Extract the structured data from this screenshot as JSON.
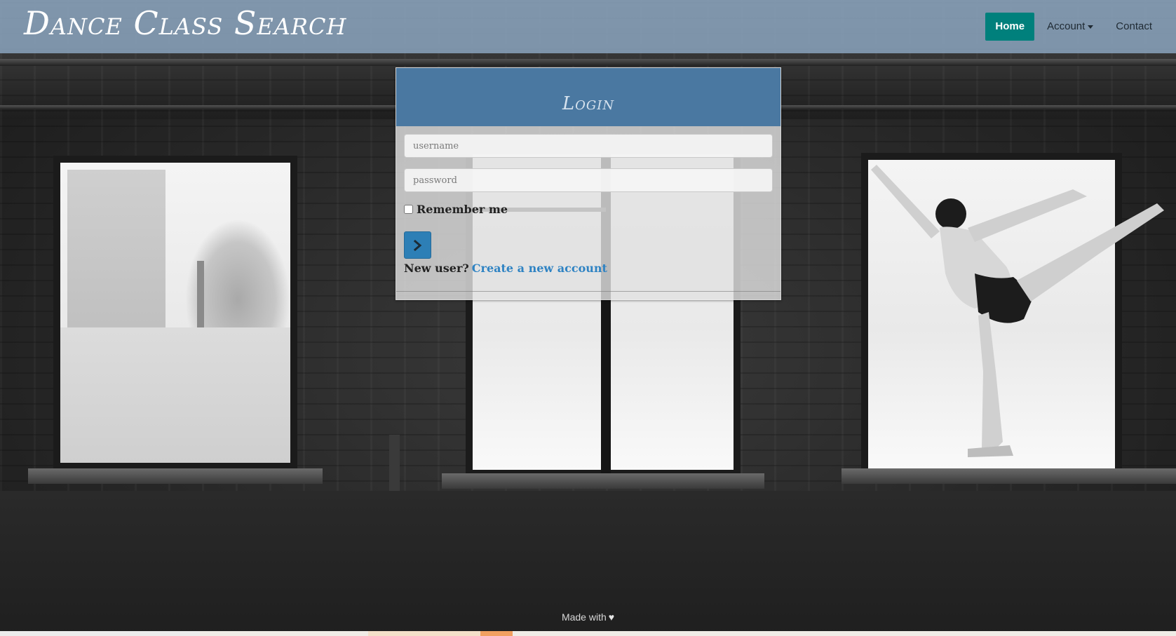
{
  "brand": {
    "title": "Dance Class Search"
  },
  "nav": {
    "items": [
      {
        "label": "Home",
        "active": true
      },
      {
        "label": "Account",
        "dropdown": true
      },
      {
        "label": "Contact"
      }
    ]
  },
  "login": {
    "title": "Login",
    "username_placeholder": "username",
    "password_placeholder": "password",
    "remember_label": "Remember me",
    "remember_checked": false,
    "submit_icon": "chevron-right-icon",
    "new_user_text": "New user?",
    "create_account_link": "Create a new account"
  },
  "footer": {
    "made_with": "Made with",
    "heart_icon": "heart-icon"
  },
  "colors": {
    "navbar": "#88a0ba",
    "home_button": "#00807c",
    "login_header": "#4a78a1",
    "submit_button": "#2d7fb6",
    "link": "#2f83c3"
  }
}
